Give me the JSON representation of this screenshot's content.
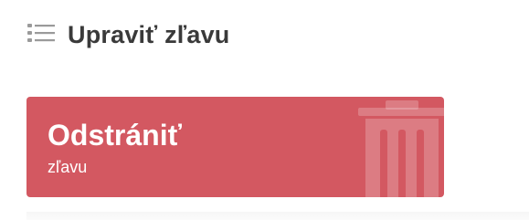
{
  "header": {
    "icon": "list-icon",
    "title": "Upraviť zľavu"
  },
  "card": {
    "title": "Odstrániť",
    "subtitle": "zľavu",
    "icon": "trash-icon",
    "color": "#d35861"
  }
}
